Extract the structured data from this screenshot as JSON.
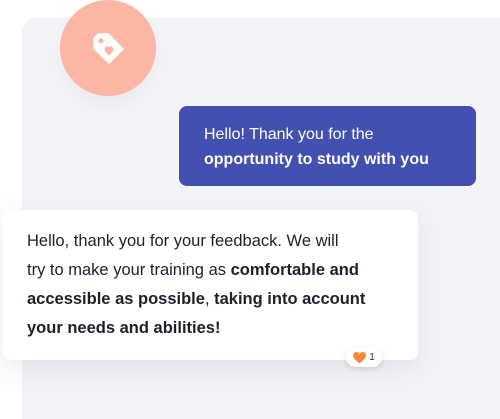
{
  "colors": {
    "panel_background": "#f3f4f8",
    "avatar_background": "#fdb6a3",
    "outgoing_bubble": "#4350af",
    "incoming_bubble": "#ffffff",
    "reaction_heart": "#f08a3c"
  },
  "avatar": {
    "icon": "heart-tag-icon"
  },
  "outgoing_message": {
    "line1": "Hello! Thank you for the",
    "line2": "opportunity to study with you"
  },
  "incoming_message": {
    "line1": "Hello, thank you for your feedback. We will",
    "line2_regular": "try to make your training as ",
    "line2_bold": "comfortable and",
    "line3_bold": "accessible as possible",
    "line3_regular": ", ",
    "line3_bold2": "taking into account",
    "line4_bold": "your needs and abilities!"
  },
  "reaction": {
    "icon": "heart-icon",
    "count": "1"
  }
}
